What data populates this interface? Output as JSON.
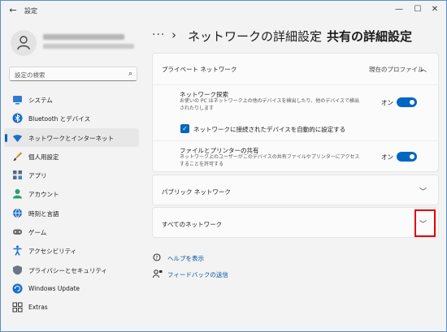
{
  "window": {
    "title": "設定",
    "back_glyph": "←",
    "min_glyph": "—",
    "max_glyph": "☐",
    "close_glyph": "✕"
  },
  "sidebar": {
    "search_placeholder": "設定の検索",
    "items": [
      {
        "label": "システム",
        "icon": "system-icon",
        "color": "#2f7bd2"
      },
      {
        "label": "Bluetooth とデバイス",
        "icon": "bluetooth-icon",
        "color": "#1a6fc9"
      },
      {
        "label": "ネットワークとインターネット",
        "icon": "wifi-icon",
        "color": "#1a6fc9",
        "active": true
      },
      {
        "label": "個人用設定",
        "icon": "brush-icon",
        "color": "#d1791f"
      },
      {
        "label": "アプリ",
        "icon": "apps-icon",
        "color": "#5b6a80"
      },
      {
        "label": "アカウント",
        "icon": "account-icon",
        "color": "#2a9d6f"
      },
      {
        "label": "時刻と言語",
        "icon": "globe-icon",
        "color": "#2574c6"
      },
      {
        "label": "ゲーム",
        "icon": "game-icon",
        "color": "#6b6b6b"
      },
      {
        "label": "アクセシビリティ",
        "icon": "accessibility-icon",
        "color": "#1f6fd0"
      },
      {
        "label": "プライバシーとセキュリティ",
        "icon": "shield-icon",
        "color": "#6b7585"
      },
      {
        "label": "Windows Update",
        "icon": "update-icon",
        "color": "#1a6fc9"
      },
      {
        "label": "Extras",
        "icon": "extras-icon",
        "color": "#333333"
      }
    ]
  },
  "breadcrumb": {
    "dots": "···",
    "sep": "›",
    "parent": "ネットワークの詳細設定",
    "current": "共有の詳細設定"
  },
  "private_network": {
    "title": "プライベート ネットワーク",
    "profile_label": "現在のプロファイル",
    "discovery_title": "ネットワーク探索",
    "discovery_desc": "お使いの PC はネットワーク上の他のデバイスを検出したり、他のデバイスで検出されたりします",
    "discovery_state": "オン",
    "auto_setup_label": "ネットワークに接続されたデバイスを自動的に設定する",
    "sharing_title": "ファイルとプリンターの共有",
    "sharing_desc": "ネットワーク上のユーザーがこのデバイスの共有ファイルやプリンターにアクセスすることを許可する",
    "sharing_state": "オン"
  },
  "public_network": {
    "title": "パブリック ネットワーク"
  },
  "all_networks": {
    "title": "すべてのネットワーク"
  },
  "links": {
    "help": "ヘルプを表示",
    "feedback": "フィードバックの送信"
  },
  "accent_color": "#0067c0",
  "highlight_color": "#e00000"
}
